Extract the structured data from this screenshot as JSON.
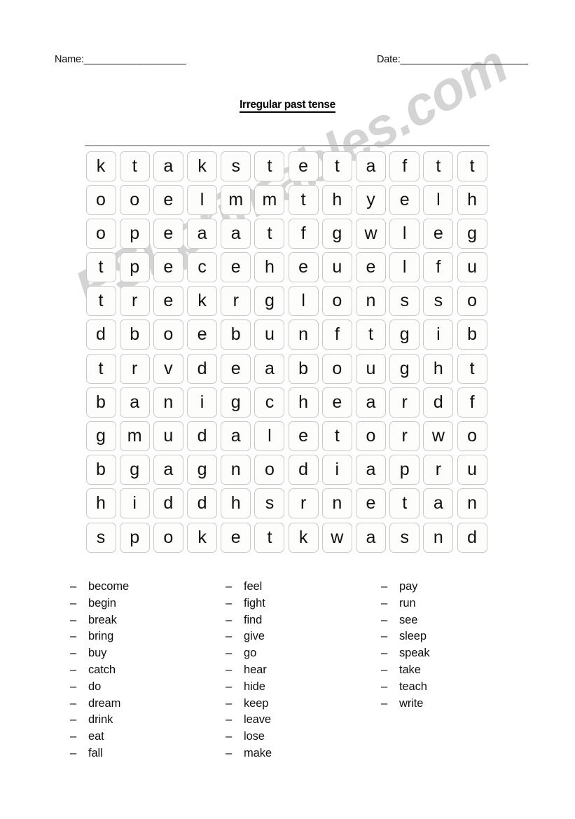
{
  "header": {
    "name_label": "Name:",
    "name_rule": "____________________",
    "date_label": "Date:",
    "date_rule": "_________________________"
  },
  "title": "Irregular past tense",
  "watermark": "ESLprintables.com",
  "puzzle": {
    "rows": 12,
    "cols": 12,
    "grid": [
      [
        "k",
        "t",
        "a",
        "k",
        "s",
        "t",
        "e",
        "t",
        "a",
        "f",
        "t",
        "t"
      ],
      [
        "o",
        "o",
        "e",
        "l",
        "m",
        "m",
        "t",
        "h",
        "y",
        "e",
        "l",
        "h"
      ],
      [
        "o",
        "p",
        "e",
        "a",
        "a",
        "t",
        "f",
        "g",
        "w",
        "l",
        "e",
        "g"
      ],
      [
        "t",
        "p",
        "e",
        "c",
        "e",
        "h",
        "e",
        "u",
        "e",
        "l",
        "f",
        "u"
      ],
      [
        "t",
        "r",
        "e",
        "k",
        "r",
        "g",
        "l",
        "o",
        "n",
        "s",
        "s",
        "o"
      ],
      [
        "d",
        "b",
        "o",
        "e",
        "b",
        "u",
        "n",
        "f",
        "t",
        "g",
        "i",
        "b"
      ],
      [
        "t",
        "r",
        "v",
        "d",
        "e",
        "a",
        "b",
        "o",
        "u",
        "g",
        "h",
        "t"
      ],
      [
        "b",
        "a",
        "n",
        "i",
        "g",
        "c",
        "h",
        "e",
        "a",
        "r",
        "d",
        "f"
      ],
      [
        "g",
        "m",
        "u",
        "d",
        "a",
        "l",
        "e",
        "t",
        "o",
        "r",
        "w",
        "o"
      ],
      [
        "b",
        "g",
        "a",
        "g",
        "n",
        "o",
        "d",
        "i",
        "a",
        "p",
        "r",
        "u"
      ],
      [
        "h",
        "i",
        "d",
        "d",
        "h",
        "s",
        "r",
        "n",
        "e",
        "t",
        "a",
        "n"
      ],
      [
        "s",
        "p",
        "o",
        "k",
        "e",
        "t",
        "k",
        "w",
        "a",
        "s",
        "n",
        "d"
      ]
    ]
  },
  "wordlist": {
    "bullet": "–",
    "columns": [
      [
        "become",
        "begin",
        "break",
        "bring",
        "buy",
        "catch",
        "do",
        "dream",
        "drink",
        "eat",
        "fall"
      ],
      [
        "feel",
        "fight",
        "find",
        "give",
        "go",
        "hear",
        "hide",
        "keep",
        "leave",
        "lose",
        "make"
      ],
      [
        "pay",
        "run",
        "see",
        "sleep",
        "speak",
        "take",
        "teach",
        "write"
      ]
    ]
  }
}
